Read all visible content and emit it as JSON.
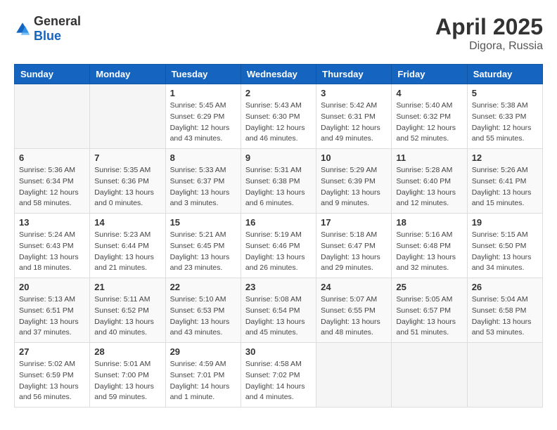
{
  "header": {
    "logo": {
      "general": "General",
      "blue": "Blue"
    },
    "title": "April 2025",
    "location": "Digora, Russia"
  },
  "calendar": {
    "days_of_week": [
      "Sunday",
      "Monday",
      "Tuesday",
      "Wednesday",
      "Thursday",
      "Friday",
      "Saturday"
    ],
    "weeks": [
      [
        {
          "day": "",
          "sunrise": "",
          "sunset": "",
          "daylight": ""
        },
        {
          "day": "",
          "sunrise": "",
          "sunset": "",
          "daylight": ""
        },
        {
          "day": "1",
          "sunrise": "Sunrise: 5:45 AM",
          "sunset": "Sunset: 6:29 PM",
          "daylight": "Daylight: 12 hours and 43 minutes."
        },
        {
          "day": "2",
          "sunrise": "Sunrise: 5:43 AM",
          "sunset": "Sunset: 6:30 PM",
          "daylight": "Daylight: 12 hours and 46 minutes."
        },
        {
          "day": "3",
          "sunrise": "Sunrise: 5:42 AM",
          "sunset": "Sunset: 6:31 PM",
          "daylight": "Daylight: 12 hours and 49 minutes."
        },
        {
          "day": "4",
          "sunrise": "Sunrise: 5:40 AM",
          "sunset": "Sunset: 6:32 PM",
          "daylight": "Daylight: 12 hours and 52 minutes."
        },
        {
          "day": "5",
          "sunrise": "Sunrise: 5:38 AM",
          "sunset": "Sunset: 6:33 PM",
          "daylight": "Daylight: 12 hours and 55 minutes."
        }
      ],
      [
        {
          "day": "6",
          "sunrise": "Sunrise: 5:36 AM",
          "sunset": "Sunset: 6:34 PM",
          "daylight": "Daylight: 12 hours and 58 minutes."
        },
        {
          "day": "7",
          "sunrise": "Sunrise: 5:35 AM",
          "sunset": "Sunset: 6:36 PM",
          "daylight": "Daylight: 13 hours and 0 minutes."
        },
        {
          "day": "8",
          "sunrise": "Sunrise: 5:33 AM",
          "sunset": "Sunset: 6:37 PM",
          "daylight": "Daylight: 13 hours and 3 minutes."
        },
        {
          "day": "9",
          "sunrise": "Sunrise: 5:31 AM",
          "sunset": "Sunset: 6:38 PM",
          "daylight": "Daylight: 13 hours and 6 minutes."
        },
        {
          "day": "10",
          "sunrise": "Sunrise: 5:29 AM",
          "sunset": "Sunset: 6:39 PM",
          "daylight": "Daylight: 13 hours and 9 minutes."
        },
        {
          "day": "11",
          "sunrise": "Sunrise: 5:28 AM",
          "sunset": "Sunset: 6:40 PM",
          "daylight": "Daylight: 13 hours and 12 minutes."
        },
        {
          "day": "12",
          "sunrise": "Sunrise: 5:26 AM",
          "sunset": "Sunset: 6:41 PM",
          "daylight": "Daylight: 13 hours and 15 minutes."
        }
      ],
      [
        {
          "day": "13",
          "sunrise": "Sunrise: 5:24 AM",
          "sunset": "Sunset: 6:43 PM",
          "daylight": "Daylight: 13 hours and 18 minutes."
        },
        {
          "day": "14",
          "sunrise": "Sunrise: 5:23 AM",
          "sunset": "Sunset: 6:44 PM",
          "daylight": "Daylight: 13 hours and 21 minutes."
        },
        {
          "day": "15",
          "sunrise": "Sunrise: 5:21 AM",
          "sunset": "Sunset: 6:45 PM",
          "daylight": "Daylight: 13 hours and 23 minutes."
        },
        {
          "day": "16",
          "sunrise": "Sunrise: 5:19 AM",
          "sunset": "Sunset: 6:46 PM",
          "daylight": "Daylight: 13 hours and 26 minutes."
        },
        {
          "day": "17",
          "sunrise": "Sunrise: 5:18 AM",
          "sunset": "Sunset: 6:47 PM",
          "daylight": "Daylight: 13 hours and 29 minutes."
        },
        {
          "day": "18",
          "sunrise": "Sunrise: 5:16 AM",
          "sunset": "Sunset: 6:48 PM",
          "daylight": "Daylight: 13 hours and 32 minutes."
        },
        {
          "day": "19",
          "sunrise": "Sunrise: 5:15 AM",
          "sunset": "Sunset: 6:50 PM",
          "daylight": "Daylight: 13 hours and 34 minutes."
        }
      ],
      [
        {
          "day": "20",
          "sunrise": "Sunrise: 5:13 AM",
          "sunset": "Sunset: 6:51 PM",
          "daylight": "Daylight: 13 hours and 37 minutes."
        },
        {
          "day": "21",
          "sunrise": "Sunrise: 5:11 AM",
          "sunset": "Sunset: 6:52 PM",
          "daylight": "Daylight: 13 hours and 40 minutes."
        },
        {
          "day": "22",
          "sunrise": "Sunrise: 5:10 AM",
          "sunset": "Sunset: 6:53 PM",
          "daylight": "Daylight: 13 hours and 43 minutes."
        },
        {
          "day": "23",
          "sunrise": "Sunrise: 5:08 AM",
          "sunset": "Sunset: 6:54 PM",
          "daylight": "Daylight: 13 hours and 45 minutes."
        },
        {
          "day": "24",
          "sunrise": "Sunrise: 5:07 AM",
          "sunset": "Sunset: 6:55 PM",
          "daylight": "Daylight: 13 hours and 48 minutes."
        },
        {
          "day": "25",
          "sunrise": "Sunrise: 5:05 AM",
          "sunset": "Sunset: 6:57 PM",
          "daylight": "Daylight: 13 hours and 51 minutes."
        },
        {
          "day": "26",
          "sunrise": "Sunrise: 5:04 AM",
          "sunset": "Sunset: 6:58 PM",
          "daylight": "Daylight: 13 hours and 53 minutes."
        }
      ],
      [
        {
          "day": "27",
          "sunrise": "Sunrise: 5:02 AM",
          "sunset": "Sunset: 6:59 PM",
          "daylight": "Daylight: 13 hours and 56 minutes."
        },
        {
          "day": "28",
          "sunrise": "Sunrise: 5:01 AM",
          "sunset": "Sunset: 7:00 PM",
          "daylight": "Daylight: 13 hours and 59 minutes."
        },
        {
          "day": "29",
          "sunrise": "Sunrise: 4:59 AM",
          "sunset": "Sunset: 7:01 PM",
          "daylight": "Daylight: 14 hours and 1 minute."
        },
        {
          "day": "30",
          "sunrise": "Sunrise: 4:58 AM",
          "sunset": "Sunset: 7:02 PM",
          "daylight": "Daylight: 14 hours and 4 minutes."
        },
        {
          "day": "",
          "sunrise": "",
          "sunset": "",
          "daylight": ""
        },
        {
          "day": "",
          "sunrise": "",
          "sunset": "",
          "daylight": ""
        },
        {
          "day": "",
          "sunrise": "",
          "sunset": "",
          "daylight": ""
        }
      ]
    ]
  }
}
